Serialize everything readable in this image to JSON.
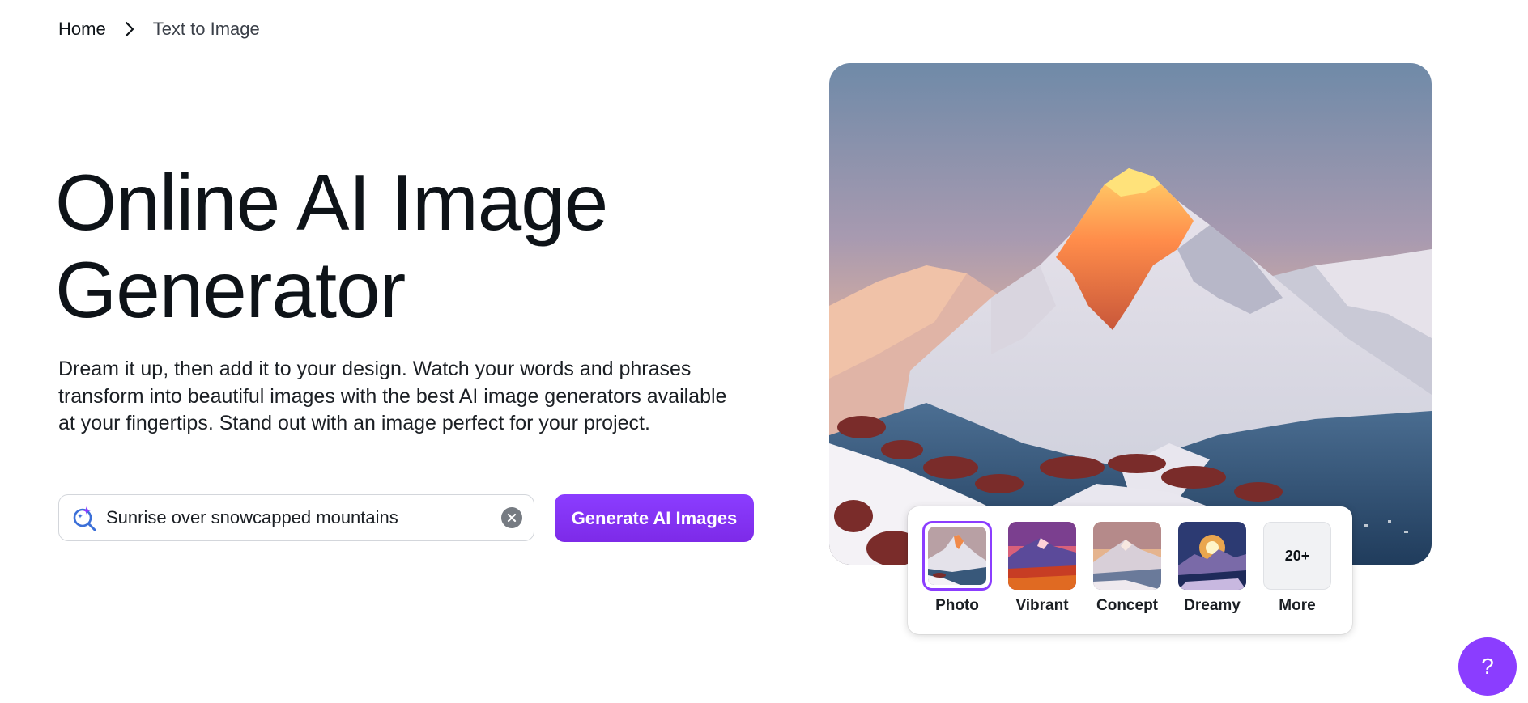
{
  "breadcrumb": {
    "home": "Home",
    "current": "Text to Image"
  },
  "hero": {
    "title_line1": "Online AI Image",
    "title_line2": "Generator",
    "description": "Dream it up, then add it to your design. Watch your words and phrases transform into beautiful images with the best AI image generators available at your fingertips. Stand out with an image perfect for your project."
  },
  "search": {
    "value": "Sunrise over snowcapped mountains",
    "icon": "magic-search-icon",
    "clear_icon": "clear-icon"
  },
  "generate_button": {
    "label": "Generate AI Images"
  },
  "styles": [
    {
      "label": "Photo",
      "selected": true
    },
    {
      "label": "Vibrant",
      "selected": false
    },
    {
      "label": "Concept",
      "selected": false
    },
    {
      "label": "Dreamy",
      "selected": false
    },
    {
      "label": "More",
      "thumb_text": "20+",
      "selected": false
    }
  ],
  "help": {
    "label": "?"
  },
  "colors": {
    "accent": "#8b3dff",
    "text": "#0e1318"
  }
}
